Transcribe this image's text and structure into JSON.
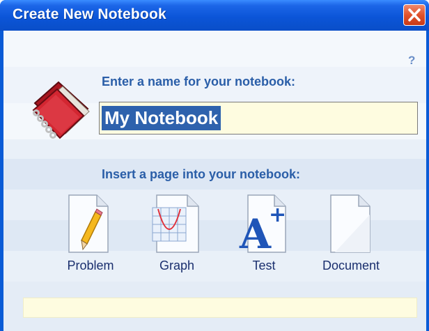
{
  "window": {
    "title": "Create New Notebook",
    "help_label": "?"
  },
  "name_section": {
    "heading": "Enter a name for your notebook:",
    "value": "My Notebook"
  },
  "page_section": {
    "heading": "Insert a page into your notebook:"
  },
  "page_types": [
    {
      "label": "Problem",
      "icon": "pencil-page-icon"
    },
    {
      "label": "Graph",
      "icon": "graph-page-icon"
    },
    {
      "label": "Test",
      "icon": "test-page-icon"
    },
    {
      "label": "Document",
      "icon": "document-page-icon"
    }
  ],
  "status_text": "",
  "colors": {
    "title_bar": "#0a55d8",
    "accent_text": "#2a5ea8",
    "input_bg": "#fefce0",
    "selection": "#2e62ad"
  }
}
